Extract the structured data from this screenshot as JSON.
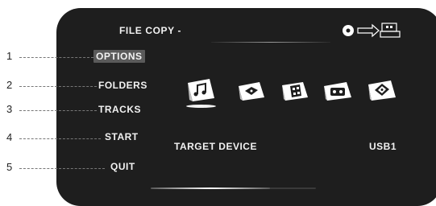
{
  "screen": {
    "title": "FILE COPY -",
    "source_icon": "disc-to-usb-copy-icon"
  },
  "menu": {
    "items": [
      {
        "number": "1",
        "label": "OPTIONS",
        "selected": true
      },
      {
        "number": "2",
        "label": "FOLDERS",
        "selected": false
      },
      {
        "number": "3",
        "label": "TRACKS",
        "selected": false
      },
      {
        "number": "4",
        "label": "START",
        "selected": false
      },
      {
        "number": "5",
        "label": "QUIT",
        "selected": false
      }
    ]
  },
  "media_types": [
    {
      "icon": "music-note-icon",
      "selected": true
    },
    {
      "icon": "video-disc-icon",
      "selected": false
    },
    {
      "icon": "film-icon",
      "selected": false
    },
    {
      "icon": "cassette-icon",
      "selected": false
    },
    {
      "icon": "photo-disc-icon",
      "selected": false
    }
  ],
  "target": {
    "label": "TARGET DEVICE",
    "device": "USB1"
  },
  "progress": 0.72,
  "colors": {
    "screen_bg": "#1e1e1e",
    "text": "#f2f2f2",
    "selection_highlight": "#5a5a5a"
  }
}
